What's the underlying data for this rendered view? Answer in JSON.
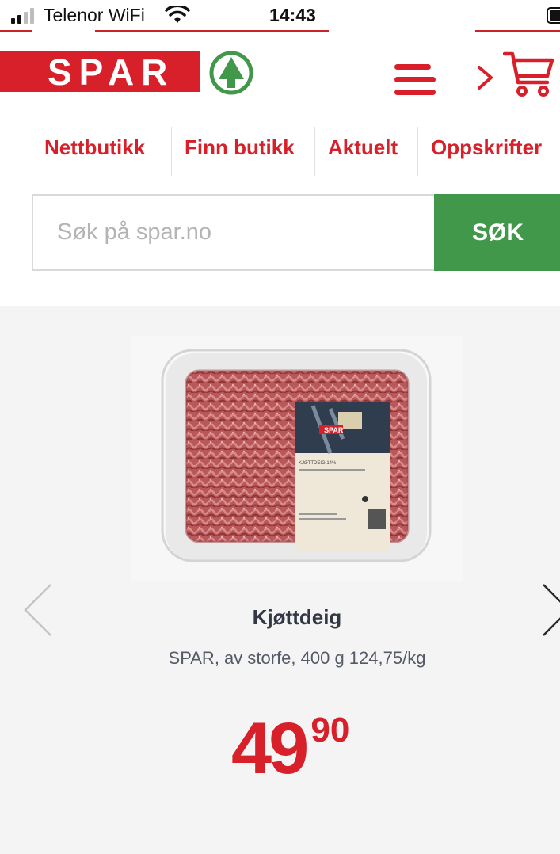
{
  "status_bar": {
    "carrier": "Telenor WiFi",
    "time": "14:43"
  },
  "brand": {
    "logo_text": "SPAR",
    "primary_color": "#d8202a",
    "green_color": "#41984b"
  },
  "nav": {
    "items": [
      {
        "label": "Nettbutikk"
      },
      {
        "label": "Finn butikk"
      },
      {
        "label": "Aktuelt"
      },
      {
        "label": "Oppskrifter"
      }
    ]
  },
  "search": {
    "placeholder": "Søk på spar.no",
    "value": "",
    "button_label": "SØK"
  },
  "product": {
    "name": "Kjøttdeig",
    "description": "SPAR, av storfe, 400 g 124,75/kg",
    "price_kr": "49",
    "price_ore": "90",
    "image": {
      "pack_label_brand": "SPAR",
      "pack_label_title": "KJØTTDEIG 14%"
    }
  },
  "icons": [
    "signal-icon",
    "wifi-icon",
    "battery-icon",
    "spar-tree-icon",
    "menu-icon",
    "chevron-right-icon",
    "cart-icon",
    "chevron-left-icon"
  ]
}
